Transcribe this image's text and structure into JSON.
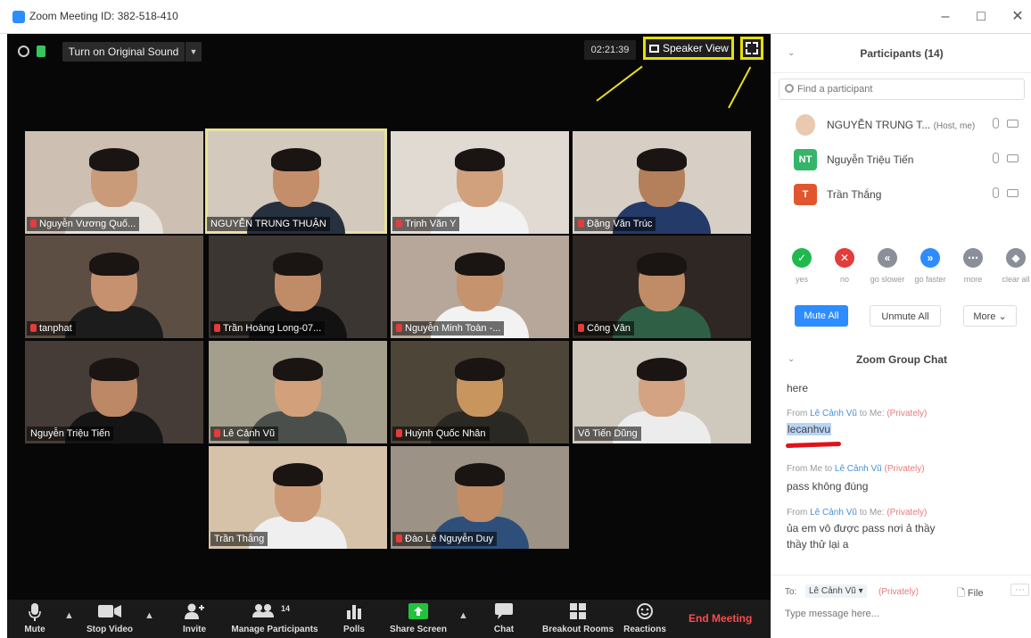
{
  "window": {
    "title": "Zoom Meeting ID: 382-518-410",
    "controls": [
      "–",
      "□",
      "✕"
    ]
  },
  "video_top": {
    "sound_button": "Turn on Original Sound",
    "timer": "02:21:39",
    "speaker_view": "Speaker View"
  },
  "tiles": [
    {
      "name": "Nguyễn Vương Quố...",
      "muted": true,
      "bg": "#cdbfb1",
      "skin": "#c99b79",
      "shirt": "#e7e2dc"
    },
    {
      "name": "NGUYỄN TRUNG THUẬN",
      "muted": false,
      "bg": "#d3c9bd",
      "skin": "#c48e6a",
      "shirt": "#26303e"
    },
    {
      "name": "Trịnh Văn Y",
      "muted": true,
      "bg": "#e0dad2",
      "skin": "#d1a07d",
      "shirt": "#f2f2f2"
    },
    {
      "name": "Đặng Văn Trúc",
      "muted": true,
      "bg": "#d7cfc6",
      "skin": "#b47f5b",
      "shirt": "#243a68"
    },
    {
      "name": "tanphat",
      "muted": true,
      "bg": "#5d4e44",
      "skin": "#c5916f",
      "shirt": "#1c1c1c"
    },
    {
      "name": "Trần Hoàng Long-07...",
      "muted": true,
      "bg": "#3c3632",
      "skin": "#c08b67",
      "shirt": "#121212"
    },
    {
      "name": "Nguyễn Minh Toàn -...",
      "muted": true,
      "bg": "#b6a79a",
      "skin": "#c5946f",
      "shirt": "#f2f2f2"
    },
    {
      "name": "Công Văn",
      "muted": true,
      "bg": "#2e2723",
      "skin": "#bf8c67",
      "shirt": "#2f6046"
    },
    {
      "name": "Nguyễn Triệu Tiến",
      "muted": false,
      "bg": "#463c37",
      "skin": "#bd8866",
      "shirt": "#151515"
    },
    {
      "name": "Lê Cảnh Vũ",
      "muted": true,
      "bg": "#a49e8c",
      "skin": "#d2a07b",
      "shirt": "#4b4f4b"
    },
    {
      "name": "Huỳnh Quốc Nhân",
      "muted": true,
      "bg": "#4c4538",
      "skin": "#c9955f",
      "shirt": "#2a2822"
    },
    {
      "name": "Võ Tiến Dũng",
      "muted": false,
      "bg": "#cfc8bd",
      "skin": "#d4a383",
      "shirt": "#ececec"
    },
    {
      "name": "Trần Thắng",
      "muted": false,
      "bg": "#d6c2a9",
      "skin": "#cd9a77",
      "shirt": "#efefef"
    },
    {
      "name": "Đào Lê Nguyễn Duy",
      "muted": true,
      "bg": "#9c9285",
      "skin": "#c08d67",
      "shirt": "#2f4f7b"
    }
  ],
  "toolbar": {
    "mute": "Mute",
    "stop_video": "Stop Video",
    "invite": "Invite",
    "manage_participants": "Manage Participants",
    "participant_count": "14",
    "polls": "Polls",
    "share_screen": "Share Screen",
    "chat": "Chat",
    "breakout_rooms": "Breakout Rooms",
    "reactions": "Reactions",
    "end_meeting": "End Meeting"
  },
  "participants_panel": {
    "title": "Participants (14)",
    "search_placeholder": "Find a participant",
    "list": [
      {
        "name": "NGUYỄN TRUNG T...",
        "role": "(Host, me)",
        "initials": "",
        "color": "#e9c9b0"
      },
      {
        "name": "Nguyễn Triệu Tiến",
        "role": "",
        "initials": "NT",
        "color": "#35b56a"
      },
      {
        "name": "Trần Thắng",
        "role": "",
        "initials": "T",
        "color": "#e2562f"
      }
    ],
    "feedback": [
      {
        "label": "yes",
        "icon": "✓",
        "color": "#1fb950"
      },
      {
        "label": "no",
        "icon": "✕",
        "color": "#e23c3c"
      },
      {
        "label": "go slower",
        "icon": "«",
        "color": "#8a8f99"
      },
      {
        "label": "go faster",
        "icon": "»",
        "color": "#2d8cff"
      },
      {
        "label": "more",
        "icon": "⋯",
        "color": "#8a8f99"
      },
      {
        "label": "clear all",
        "icon": "◆",
        "color": "#8a8f99"
      }
    ],
    "mute_all": "Mute All",
    "unmute_all": "Unmute All",
    "more": "More"
  },
  "chat": {
    "title": "Zoom Group Chat",
    "first_msg": "here",
    "messages": [
      {
        "from": "From",
        "who": "Lê Cảnh Vũ",
        "to": "to Me:",
        "private": "(Privately)",
        "text": "lecanhvu"
      },
      {
        "from": "From Me to",
        "who": "Lê Cảnh Vũ",
        "to": "",
        "private": "(Privately)",
        "text": "pass không đúng"
      },
      {
        "from": "From",
        "who": "Lê Cảnh Vũ",
        "to": "to Me:",
        "private": "(Privately)",
        "text": "ủa em vô được pass nơi ả thầy",
        "text2": "thầy thử lại a"
      }
    ],
    "to_label": "To:",
    "recipient": "Lê Cảnh Vũ ▾",
    "privately": "(Privately)",
    "file": "File",
    "more": "···",
    "compose_placeholder": "Type message here..."
  }
}
